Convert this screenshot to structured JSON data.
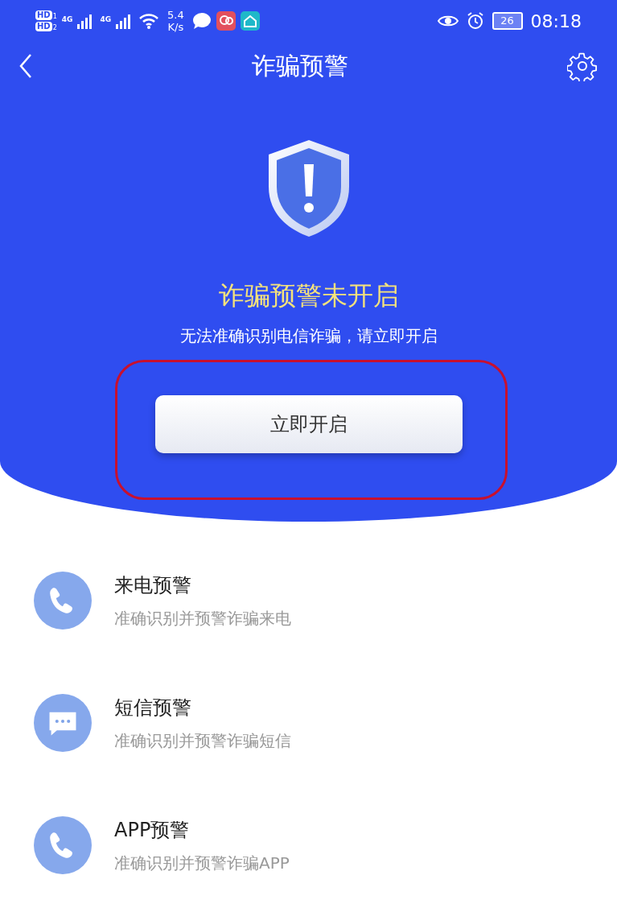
{
  "status_bar": {
    "sims": [
      {
        "badge": "HD",
        "index": "1",
        "network": "4G"
      },
      {
        "badge": "HD",
        "index": "2",
        "network": "4G"
      }
    ],
    "speed_value": "5.4",
    "speed_unit": "K/s",
    "battery": "26",
    "time": "08:18"
  },
  "nav": {
    "title": "诈骗预警"
  },
  "hero": {
    "headline": "诈骗预警未开启",
    "subtitle": "无法准确识别电信诈骗，请立即开启",
    "button": "立即开启",
    "highlighted": true
  },
  "features": [
    {
      "kind": "phone",
      "title": "来电预警",
      "subtitle": "准确识别并预警诈骗来电"
    },
    {
      "kind": "message",
      "title": "短信预警",
      "subtitle": "准确识别并预警诈骗短信"
    },
    {
      "kind": "phone",
      "title": "APP预警",
      "subtitle": "准确识别并预警诈骗APP"
    }
  ]
}
